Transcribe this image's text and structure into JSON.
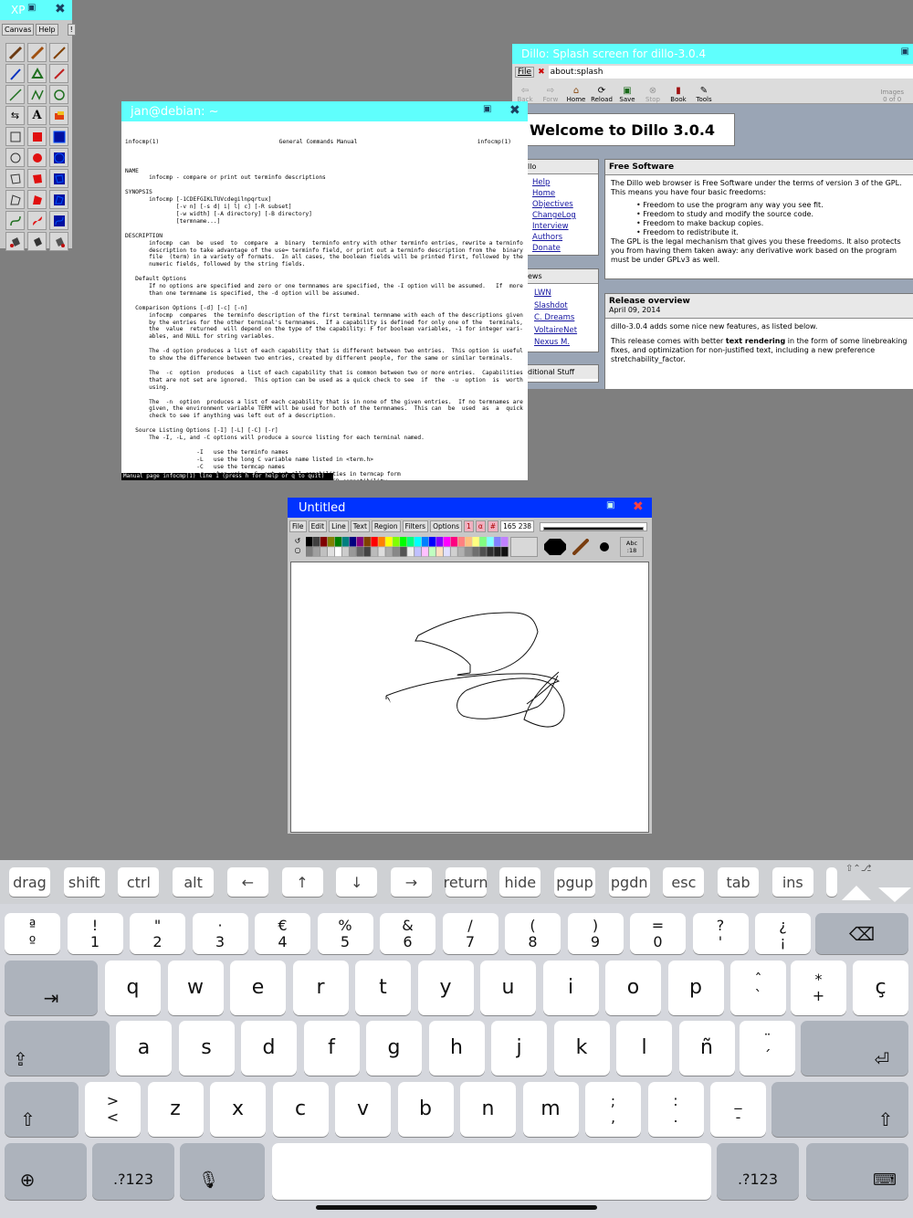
{
  "xp": {
    "title": "XP",
    "menu": [
      "Canvas",
      "Help",
      "!"
    ]
  },
  "man": {
    "title": "jan@debian: ~",
    "header_left": "infocmp(1)",
    "header_center": "General Commands Manual",
    "header_right": "infocmp(1)",
    "body": "NAME\n       infocmp - compare or print out terminfo descriptions\n\nSYNOPSIS\n       infocmp [-1CDEFGIKLTUVcdegilnpqrtux]\n               [-v n] [-s d| i| l| c] [-R subset]\n               [-w width] [-A directory] [-B directory]\n               [termname...]\n\nDESCRIPTION\n       infocmp  can  be  used  to  compare  a  binary  terminfo entry with other terminfo entries, rewrite a terminfo\n       description to take advantage of the use= terminfo field, or print out a terminfo description from the  binary\n       file  (term) in a variety of formats.  In all cases, the boolean fields will be printed first, followed by the\n       numeric fields, followed by the string fields.\n\n   Default Options\n       If no options are specified and zero or one termnames are specified, the -I option will be assumed.   If  more\n       than one termname is specified, the -d option will be assumed.\n\n   Comparison Options [-d] [-c] [-n]\n       infocmp  compares  the terminfo description of the first terminal termname with each of the descriptions given\n       by the entries for the other terminal's termnames.  If a capability is defined for only one of the  terminals,\n       the  value  returned  will depend on the type of the capability: F for boolean variables, -1 for integer vari-\n       ables, and NULL for string variables.\n\n       The -d option produces a list of each capability that is different between two entries.  This option is useful\n       to show the difference between two entries, created by different people, for the same or similar terminals.\n\n       The  -c  option  produces  a list of each capability that is common between two or more entries.  Capabilities\n       that are not set are ignored.  This option can be used as a quick check to see  if  the  -u  option  is  worth\n       using.\n\n       The  -n  option  produces a list of each capability that is in none of the given entries.  If no termnames are\n       given, the environment variable TERM will be used for both of the termnames.  This can  be  used  as  a  quick\n       check to see if anything was left out of a description.\n\n   Source Listing Options [-I] [-L] [-C] [-r]\n       The -I, -L, and -C options will produce a source listing for each terminal named.\n\n                     -I   use the terminfo names\n                     -L   use the long C variable name listed in <term.h>\n                     -C   use the termcap names\n                     -r   when using -C, put out all capabilities in termcap form\n                     -K   modifies the -C option, improving BSD-compatibility.\n\n       If no termnames are given, the environment variable TERM will be used for the terminal name.",
    "status": "Manual page infocmp(1) line 1 (press h for help or q to quit)"
  },
  "dillo": {
    "title": "Dillo: Splash screen for dillo-3.0.4",
    "file_menu": "File",
    "url": "about:splash",
    "toolbar": [
      {
        "label": "Back",
        "icon": "back-arrow-icon"
      },
      {
        "label": "Forw",
        "icon": "forward-arrow-icon"
      },
      {
        "label": "Home",
        "icon": "home-icon"
      },
      {
        "label": "Reload",
        "icon": "reload-icon"
      },
      {
        "label": "Save",
        "icon": "save-icon"
      },
      {
        "label": "Stop",
        "icon": "stop-icon"
      },
      {
        "label": "Book",
        "icon": "bookmark-icon"
      },
      {
        "label": "Tools",
        "icon": "tools-icon"
      }
    ],
    "images_label": "Images",
    "images_count": "0 of 0",
    "welcome": "Welcome to Dillo 3.0.4",
    "side1_title": "llo",
    "side1_links": [
      "Help",
      "Home",
      "Objectives",
      "ChangeLog",
      "Interview",
      "Authors",
      "Donate"
    ],
    "side2_title": "ews",
    "side2_links": [
      "LWN",
      "Slashdot",
      "C. Dreams",
      "VoltaireNet",
      "Nexus M."
    ],
    "side3_title": "ditional Stuff",
    "free_title": "Free Software",
    "free_p1": "The Dillo web browser is Free Software under the terms of version 3 of the GPL. This means you have four basic freedoms:",
    "free_list": [
      "Freedom to use the program any way you see fit.",
      "Freedom to study and modify the source code.",
      "Freedom to make backup copies.",
      "Freedom to redistribute it."
    ],
    "free_p2": "The GPL is the legal mechanism that gives you these freedoms. It also protects you from having them taken away: any derivative work based on the program must be under GPLv3 as well.",
    "release_title": "Release overview",
    "release_date": "April 09, 2014",
    "release_p1": "dillo-3.0.4 adds some nice new features, as listed below.",
    "release_p2a": "This release comes with better ",
    "release_p2b": "text rendering",
    "release_p2c": " in the form of some linebreaking fixes, and optimization for non-justified text, including a new preference stretchability_factor."
  },
  "paint": {
    "title": "Untitled",
    "menu": [
      "File",
      "Edit",
      "Line",
      "Text",
      "Region",
      "Filters",
      "Options"
    ],
    "pink_buttons": [
      "1",
      "α",
      "#"
    ],
    "coords": "165 238",
    "font_label_top": "Abc",
    "font_label_bottom": ":18"
  },
  "keyboard_bar": [
    "drag",
    "shift",
    "ctrl",
    "alt",
    "←",
    "↑",
    "↓",
    "→",
    "return",
    "hide",
    "pgup",
    "pgdn",
    "esc",
    "tab",
    "ins"
  ],
  "keyboard": {
    "row1": [
      [
        "ª",
        "º"
      ],
      [
        "!",
        "1"
      ],
      [
        "\"",
        "2"
      ],
      [
        "·",
        "3"
      ],
      [
        "€",
        "4"
      ],
      [
        "%",
        "5"
      ],
      [
        "&",
        "6"
      ],
      [
        "/",
        "7"
      ],
      [
        "(",
        "8"
      ],
      [
        ")",
        "9"
      ],
      [
        "=",
        "0"
      ],
      [
        "?",
        "'"
      ],
      [
        "¿",
        "¡"
      ]
    ],
    "row2": [
      "q",
      "w",
      "e",
      "r",
      "t",
      "y",
      "u",
      "i",
      "o",
      "p"
    ],
    "row2_extra": [
      [
        "ˆ",
        "`"
      ],
      [
        "*",
        "+"
      ],
      [
        "ç",
        ""
      ]
    ],
    "row3": [
      "a",
      "s",
      "d",
      "f",
      "g",
      "h",
      "j",
      "k",
      "l",
      "ñ"
    ],
    "row3_extra": [
      [
        "¨",
        "´"
      ]
    ],
    "row4": [
      [
        ">",
        "<"
      ],
      [
        "z",
        ""
      ],
      [
        "x",
        ""
      ],
      [
        "c",
        ""
      ],
      [
        "v",
        ""
      ],
      [
        "b",
        ""
      ],
      [
        "n",
        ""
      ],
      [
        "m",
        ""
      ],
      [
        ";",
        ","
      ],
      [
        ":",
        "."
      ],
      [
        "_",
        "-"
      ]
    ],
    "numkey": ".?123"
  },
  "colors": {
    "title_cyan": "#5ffffd",
    "paint_title_blue": "#0033ff",
    "desktop": "#7f7f7f"
  }
}
